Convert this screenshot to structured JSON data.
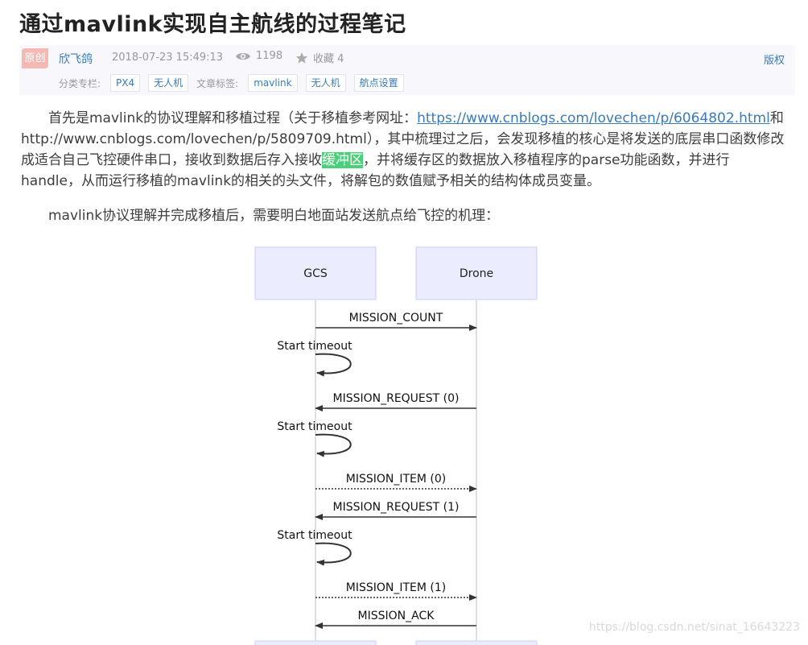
{
  "article": {
    "title": "通过mavlink实现自主航线的过程笔记"
  },
  "meta": {
    "badge": "原创",
    "author": "欣飞鸽",
    "datetime": "2018-07-23 15:49:13",
    "views": "1198",
    "favorite_label": "收藏 4",
    "copyright": "版权",
    "category_label": "分类专栏:",
    "categories": [
      "PX4",
      "无人机"
    ],
    "tags_label": "文章标签:",
    "tags": [
      "mavlink",
      "无人机",
      "航点设置"
    ]
  },
  "paragraph1": {
    "line1_pre": "首先是mavlink的协议理解和移植过程（关于移植参考网址：",
    "link1": "https://www.cnblogs.com/lovechen/p/6064802.html",
    "line1_post": "和",
    "line2": "http://www.cnblogs.com/lovechen/p/5809709.html），其中梳理过之后，会发现移植的核心是将发送的底层串口函数修改",
    "line3_pre": "成适合自己飞控硬件串口，接收到数据后存入接收",
    "line3_hl": "缓冲区",
    "line3_post": "，并将缓存区的数据放入移植程序的parse功能函数，并进行",
    "line4": "handle，从而运行移植的mavlink的相关的头文件，将解包的数值赋予相关的结构体成员变量。"
  },
  "paragraph2": "mavlink协议理解并完成移植后，需要明白地面站发送航点给飞控的机理：",
  "sequence": {
    "participants": [
      "GCS",
      "Drone"
    ],
    "timeout_label": "Start timeout",
    "messages": [
      {
        "label": "MISSION_COUNT",
        "direction": "right",
        "style": "solid"
      },
      {
        "label": "MISSION_REQUEST (0)",
        "direction": "left",
        "style": "solid"
      },
      {
        "label": "MISSION_ITEM (0)",
        "direction": "right",
        "style": "dotted"
      },
      {
        "label": "MISSION_REQUEST (1)",
        "direction": "left",
        "style": "solid"
      },
      {
        "label": "MISSION_ITEM (1)",
        "direction": "right",
        "style": "dotted"
      },
      {
        "label": "MISSION_ACK",
        "direction": "left",
        "style": "solid"
      }
    ]
  },
  "watermark": "https://blog.csdn.net/sinat_16643223",
  "colors": {
    "link": "#3a7ab8",
    "badge": "#f6b8b4",
    "highlight": "#4bd07a",
    "actor_fill": "#ececff",
    "actor_border": "#ccccff"
  }
}
